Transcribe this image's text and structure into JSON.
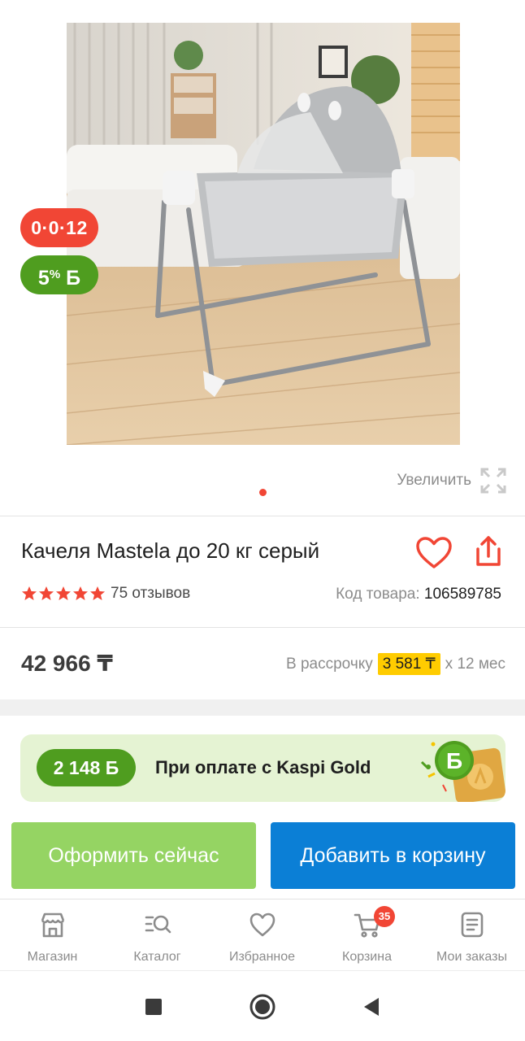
{
  "product_image": {
    "alt": "Качеля Mastela",
    "slide_indicator_active": 1
  },
  "badges": {
    "installment": "0·0·12",
    "bonus_percent": "5",
    "bonus_sign": "%",
    "bonus_currency": "Б"
  },
  "zoom": {
    "label": "Увеличить",
    "icon": "expand-icon"
  },
  "product": {
    "title": "Качеля Mastela до 20 кг серый",
    "rating": 5,
    "reviews": "75 отзывов",
    "sku_label": "Код товара:",
    "sku_value": "106589785"
  },
  "price": {
    "value": "42 966 ₸",
    "installment_prefix": "В рассрочку",
    "installment_amount": "3 581 ₸",
    "installment_suffix": "x 12 мес"
  },
  "kaspi_gold": {
    "bonus": "2 148 Б",
    "text": "При оплате с Kaspi Gold"
  },
  "actions": {
    "buy_now": "Оформить сейчас",
    "add_to_cart": "Добавить в корзину"
  },
  "tabbar": {
    "items": [
      {
        "label": "Магазин",
        "icon": "store-icon"
      },
      {
        "label": "Каталог",
        "icon": "catalog-search-icon"
      },
      {
        "label": "Избранное",
        "icon": "heart-icon"
      },
      {
        "label": "Корзина",
        "icon": "cart-icon",
        "badge": "35"
      },
      {
        "label": "Мои заказы",
        "icon": "orders-icon"
      }
    ]
  },
  "colors": {
    "kaspi_red": "#f14635",
    "bonus_green": "#4f9d1f",
    "buy_green": "#95d463",
    "cart_blue": "#0b7fd6",
    "installment_yellow": "#ffcc00"
  }
}
